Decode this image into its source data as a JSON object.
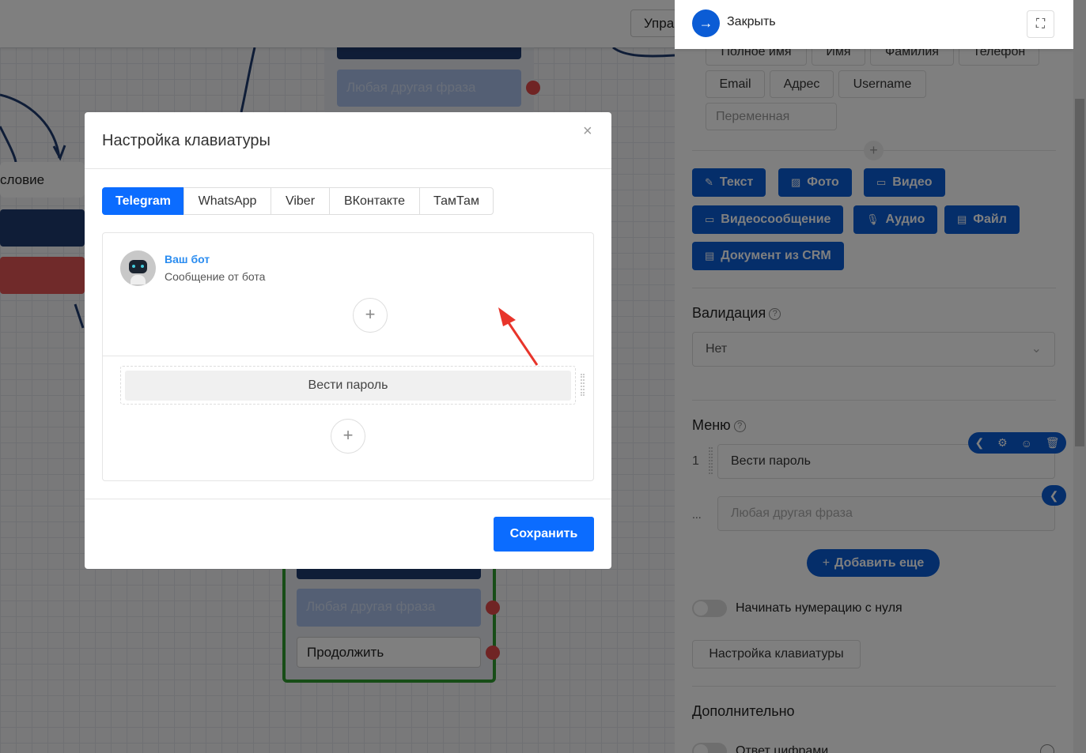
{
  "topbar": {
    "manage_label": "Упра"
  },
  "canvas": {
    "condition_label": "словие",
    "node_top": {
      "other_phrase": "Любая другая фраза"
    },
    "node_bottom": {
      "other_phrase": "Любая другая фраза",
      "continue": "Продолжить"
    }
  },
  "panel": {
    "close_label": "Закрыть",
    "variable_chips": [
      "Полное имя",
      "Имя",
      "Фамилия",
      "Телефон",
      "Email",
      "Адрес",
      "Username"
    ],
    "variable_placeholder": "Переменная",
    "media_buttons": [
      "Текст",
      "Фото",
      "Видео",
      "Видеосообщение",
      "Аудио",
      "Файл",
      "Документ из CRM"
    ],
    "validation_label": "Валидация",
    "validation_value": "Нет",
    "menu_label": "Меню",
    "menu_items": [
      {
        "num": "1",
        "value": "Вести пароль"
      }
    ],
    "other_num": "...",
    "other_placeholder": "Любая другая фраза",
    "add_more": "Добавить еще",
    "zero_numbering": "Начинать нумерацию с нуля",
    "keyboard_settings": "Настройка клавиатуры",
    "extra_label": "Дополнительно",
    "digits_answer": "Ответ цифрами"
  },
  "modal": {
    "title": "Настройка клавиатуры",
    "tabs": [
      "Telegram",
      "WhatsApp",
      "Viber",
      "ВКонтакте",
      "ТамТам"
    ],
    "active_tab": "Telegram",
    "bot_name": "Ваш бот",
    "bot_message": "Сообщение от бота",
    "button_label": "Вести пароль",
    "save": "Сохранить"
  },
  "colors": {
    "accent": "#0b6cff",
    "panel_blue": "#0b5cd5",
    "arrow": "#e8352b"
  }
}
